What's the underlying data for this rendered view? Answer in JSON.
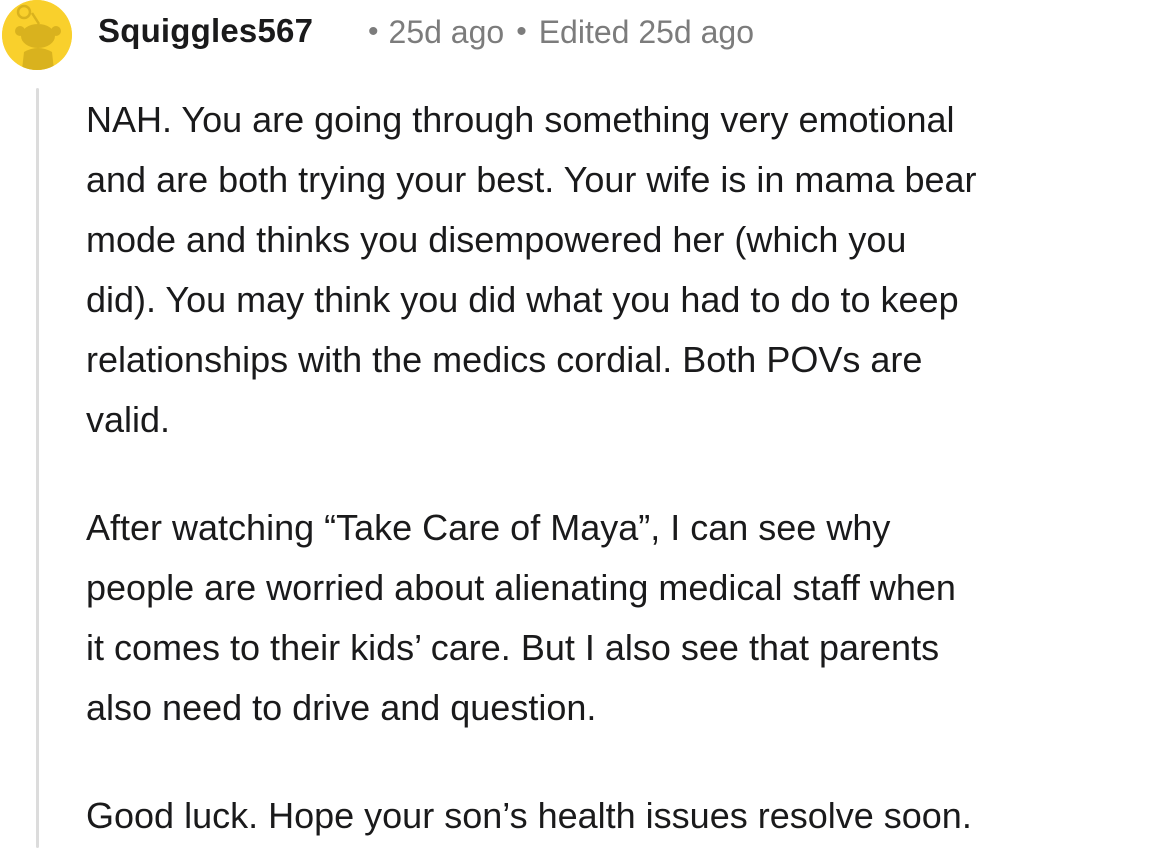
{
  "comment": {
    "author": "Squiggles567",
    "posted": "25d ago",
    "edited": "Edited 25d ago",
    "separator": "•",
    "paragraphs": [
      [
        "NAH. You are going through something very emotional",
        "and are both trying your best. Your wife is in mama bear",
        "mode and thinks you disempowered her (which you",
        "did). You may think you did what you had to do to keep",
        "relationships with the medics cordial. Both POVs are",
        "valid."
      ],
      [
        "After watching “Take Care of Maya”, I can see why",
        "people are worried about alienating medical staff when",
        "it comes to their kids’ care. But I also see that parents",
        "also need to drive and question."
      ],
      [
        "Good luck. Hope your son’s health issues resolve soon."
      ]
    ]
  },
  "colors": {
    "avatar_bg": "#f9d02c",
    "meta_text": "#7c7c7c",
    "thread_line": "#dcdcdc",
    "body_text": "#1a1a1b"
  },
  "icons": {
    "avatar": "snoo-avatar-icon"
  }
}
